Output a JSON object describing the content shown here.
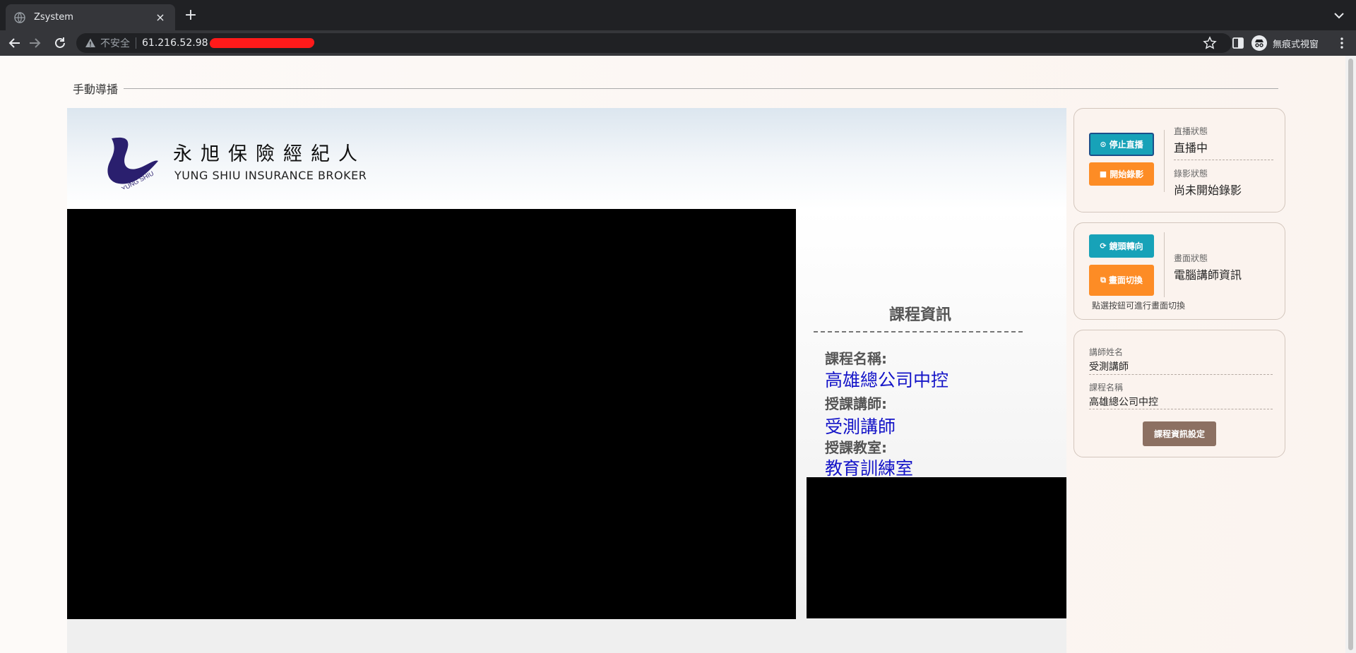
{
  "browser": {
    "tab_title": "Zsystem",
    "tab_close": "×",
    "new_tab": "+",
    "insecure_label": "不安全",
    "url": "61.216.52.98",
    "incognito_label": "無痕式視窗"
  },
  "page": {
    "legend": "手動導播",
    "brand": {
      "cn": "永旭保險經紀人",
      "en": "YUNG SHIU INSURANCE BROKER",
      "logo_text": "YUNG SHIU"
    },
    "course_panel": {
      "title": "課程資訊",
      "name_label": "課程名稱:",
      "name_value": "高雄總公司中控",
      "teacher_label": "授課講師:",
      "teacher_value": "受測講師",
      "room_label": "授課教室:",
      "room_value": "教育訓練室"
    }
  },
  "controls": {
    "broadcast_card": {
      "stop_live_label": "停止直播",
      "start_record_label": "開始錄影",
      "live_status_label": "直播狀態",
      "live_status_value": "直播中",
      "record_status_label": "錄影狀態",
      "record_status_value": "尚未開始錄影"
    },
    "view_card": {
      "flip_label": "鏡頭轉向",
      "switch_label": "畫面切換",
      "view_status_label": "畫面狀態",
      "view_status_value": "電腦講師資訊",
      "hint": "點選按鈕可進行畫面切換"
    },
    "info_card": {
      "teacher_label": "講師姓名",
      "teacher_value": "受測講師",
      "course_label": "課程名稱",
      "course_value": "高雄總公司中控",
      "settings_button": "課程資訊設定"
    }
  },
  "colors": {
    "accent_blue": "#17a2b8",
    "accent_orange": "#fd8c25",
    "brown_button": "#8c7062",
    "course_value_blue": "#1515c8"
  }
}
